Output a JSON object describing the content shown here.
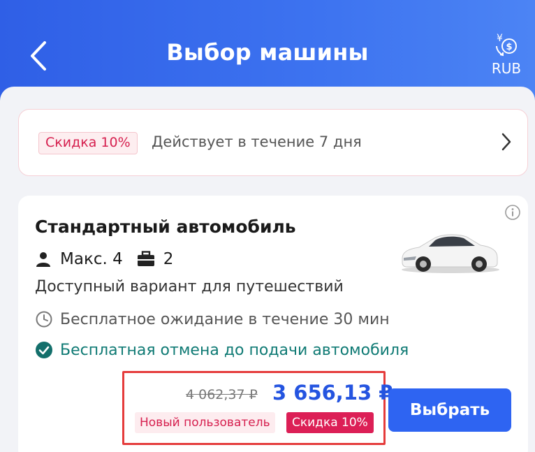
{
  "header": {
    "title": "Выбор машины",
    "currency": "RUB",
    "back_icon": "chevron-left-icon",
    "currency_icon": "currency-exchange-icon",
    "gradient": "#2f5fe6"
  },
  "promo": {
    "badge": "Скидка 10%",
    "text": "Действует в течение 7 дня",
    "chevron_icon": "chevron-right-icon"
  },
  "car": {
    "name": "Стандартный автомобиль",
    "passengers": "Макс. 4",
    "luggage": "2",
    "description": "Доступный вариант для путешествий",
    "waiting": "Бесплатное ожидание в течение 30 мин",
    "cancellation": "Бесплатная отмена до подачи автомобиля",
    "old_price": "4 062,37 ₽",
    "new_price": "3 656,13 ₽",
    "tag_new_user": "Новый пользователь",
    "tag_discount": "Скидка 10%",
    "select_label": "Выбрать"
  },
  "colors": {
    "accent": "#2e64f2",
    "discount": "#dc1f56",
    "cancel_text": "#0f7a74",
    "highlight_box": "#e53b3b"
  }
}
